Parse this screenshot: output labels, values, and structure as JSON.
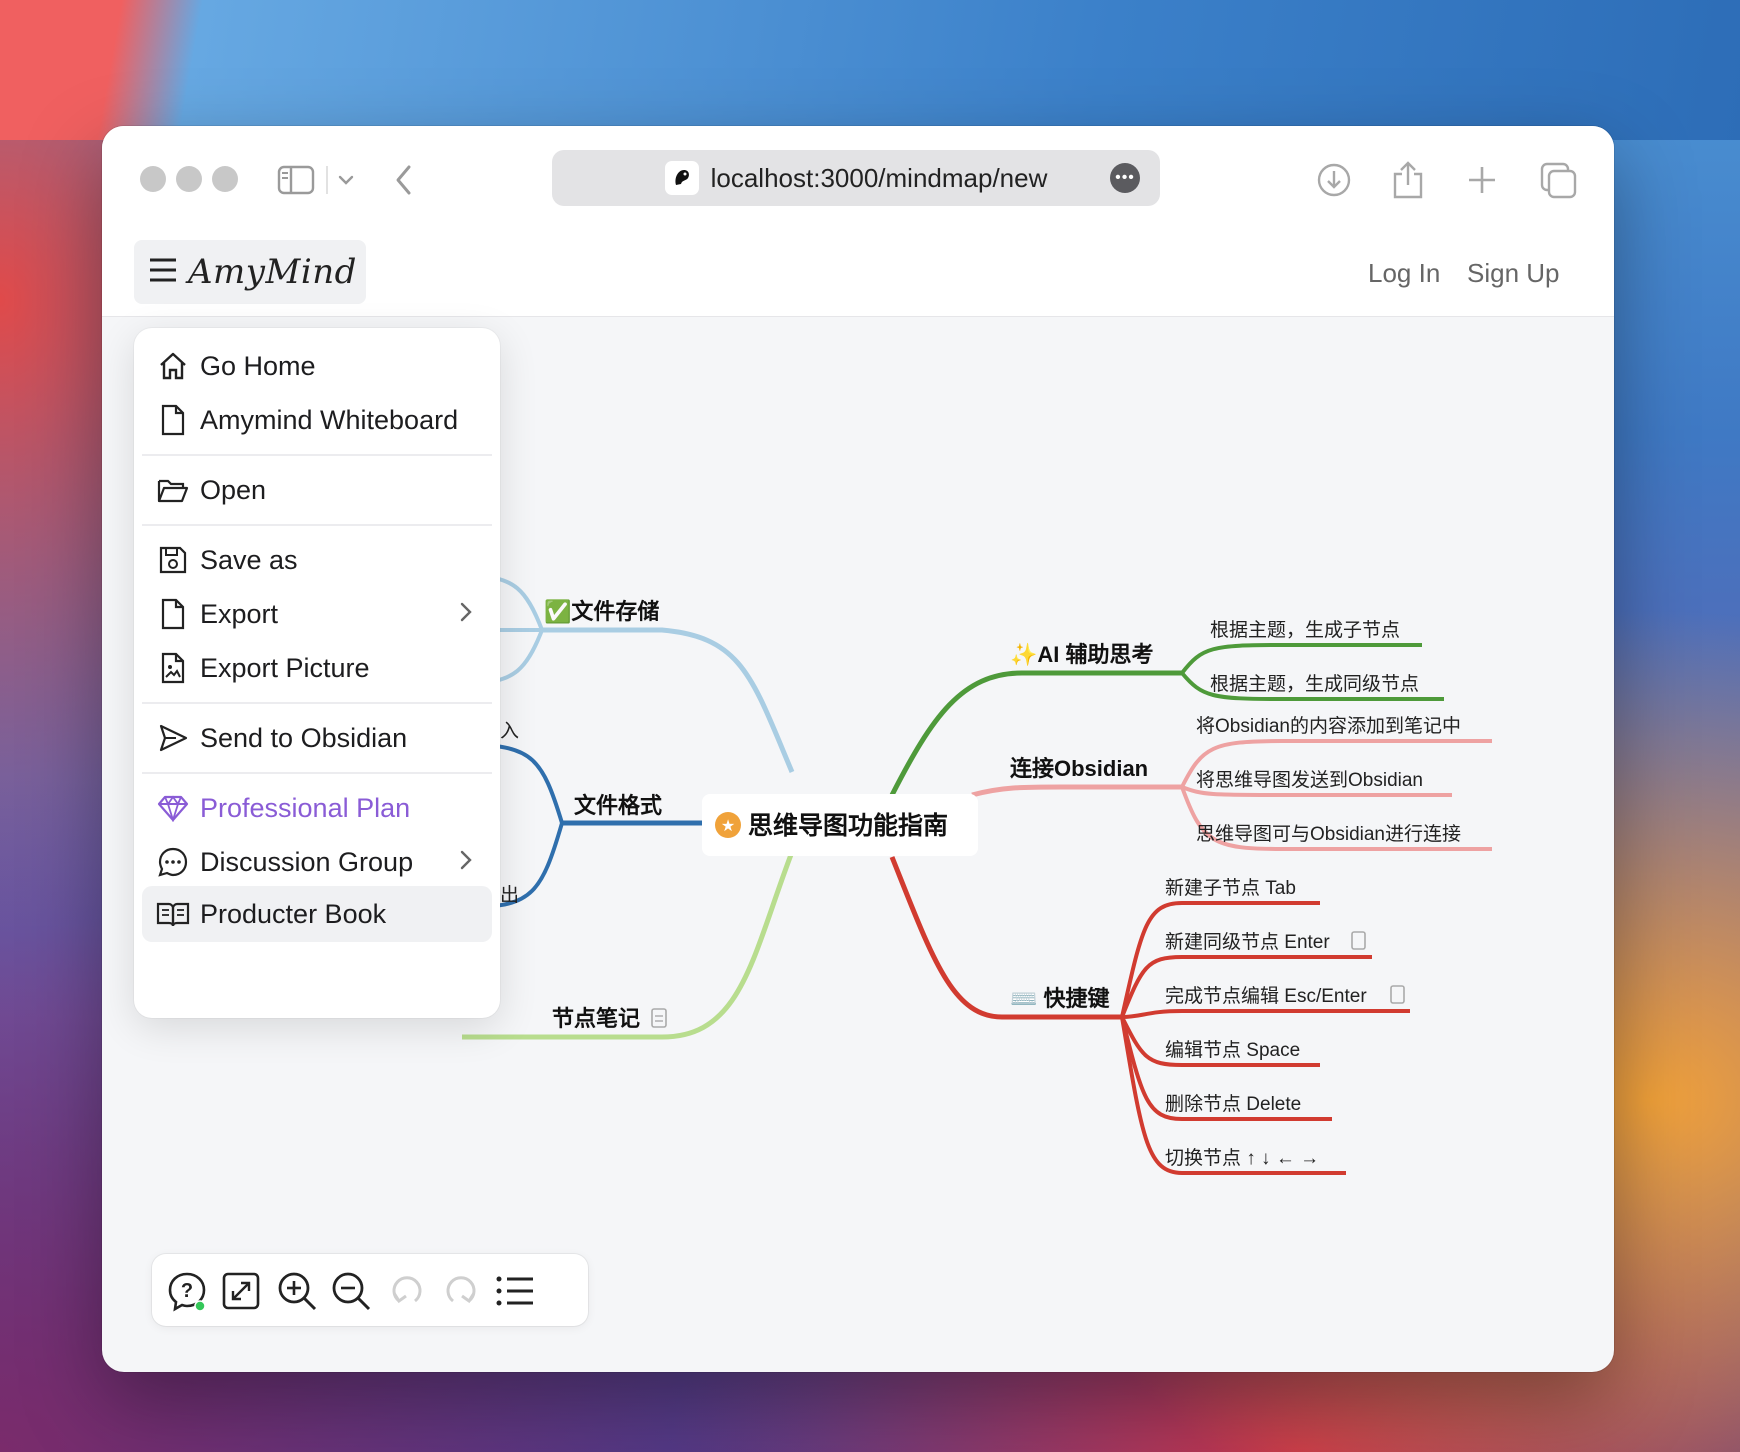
{
  "browser": {
    "url": "localhost:3000/mindmap/new",
    "url_more_glyph": "•••"
  },
  "app": {
    "brand": "AmyMind",
    "login": "Log In",
    "signup": "Sign Up"
  },
  "menu": {
    "items": [
      {
        "label": "Go Home",
        "icon": "home-icon"
      },
      {
        "label": "Amymind Whiteboard",
        "icon": "file-icon"
      },
      {
        "label": "Open",
        "icon": "folder-open-icon"
      },
      {
        "label": "Save as",
        "icon": "save-icon"
      },
      {
        "label": "Export",
        "icon": "file-icon",
        "submenu": true
      },
      {
        "label": "Export Picture",
        "icon": "image-file-icon"
      },
      {
        "label": "Send to Obsidian",
        "icon": "send-icon"
      },
      {
        "label": "Professional Plan",
        "icon": "diamond-icon",
        "color": "#8a5cd6"
      },
      {
        "label": "Discussion Group",
        "icon": "chat-bubble-icon",
        "submenu": true
      },
      {
        "label": "Producter Book",
        "icon": "book-icon",
        "active": true
      }
    ]
  },
  "mindmap": {
    "root": "思维导图功能指南",
    "left": [
      {
        "label": "✅文件存储",
        "color": "#a9cde3"
      },
      {
        "label": "文件格式",
        "color": "#2f6fad",
        "partial_children": [
          "入",
          "出"
        ]
      },
      {
        "label": "节点笔记",
        "color": "#b8dd8e",
        "partial_children": [
          "·"
        ]
      }
    ],
    "right": [
      {
        "label": "✨AI 辅助思考",
        "color": "#4e9a3a",
        "children": [
          "根据主题，生成子节点",
          "根据主题，生成同级节点"
        ]
      },
      {
        "label": "连接Obsidian",
        "color": "#eea2a2",
        "children": [
          "将Obsidian的内容添加到笔记中",
          "将思维导图发送到Obsidian",
          "思维导图可与Obsidian进行连接"
        ]
      },
      {
        "label": "⌨️ 快捷键",
        "color": "#d13b30",
        "children": [
          "新建子节点 Tab",
          "新建同级节点 Enter",
          "完成节点编辑 Esc/Enter",
          "编辑节点 Space",
          "删除节点 Delete",
          "切换节点 ↑ ↓ ← →"
        ]
      }
    ]
  },
  "toolbar": {
    "tools": [
      "help-chat-icon",
      "fit-screen-icon",
      "zoom-in-icon",
      "zoom-out-icon",
      "undo-icon",
      "redo-icon",
      "outline-list-icon"
    ],
    "status_color": "#34c759"
  }
}
